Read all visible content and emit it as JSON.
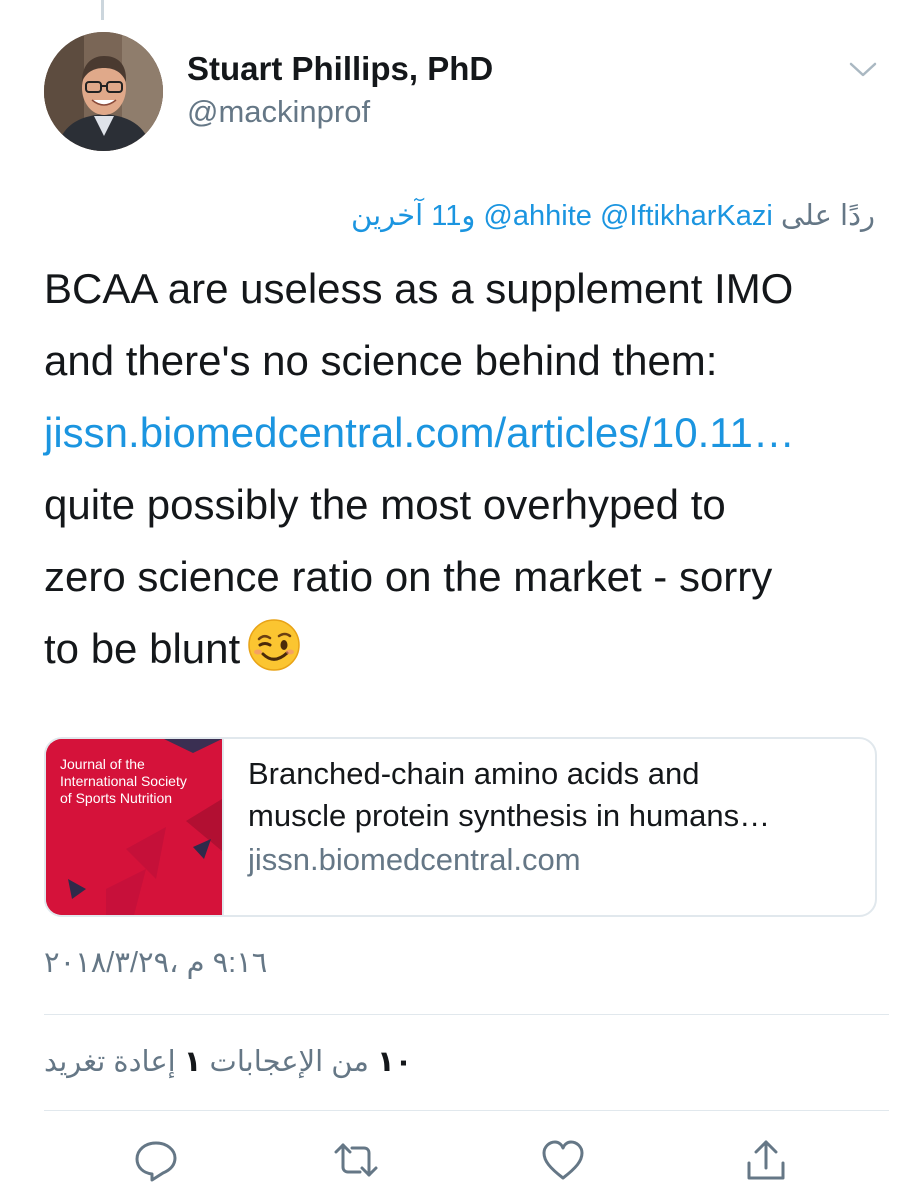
{
  "author": {
    "name": "Stuart Phillips, PhD",
    "handle": "@mackinprof"
  },
  "reply": {
    "prefix": "ردًا على",
    "mention_1": "@IftikharKazi",
    "mention_2": "@ahhite",
    "others": "و11 آخرين"
  },
  "tweet": {
    "line_1": "BCAA are useless as a supplement IMO",
    "line_2": "and there's no science behind them:",
    "link": "jissn.biomedcentral.com/articles/10.11…",
    "line_4": "quite possibly the most overhyped to",
    "line_5": "zero science ratio on the market - sorry",
    "line_6": "to be blunt",
    "emoji": "winking-face"
  },
  "card": {
    "thumb_line_1": "Journal of the",
    "thumb_line_2": "International Society",
    "thumb_line_3": "of Sports Nutrition",
    "title_line_1": "Branched-chain amino acids and",
    "title_line_2": "muscle protein synthesis in humans…",
    "domain": "jissn.biomedcentral.com",
    "thumb_color": "#d5123a"
  },
  "timestamp": "٩:١٦ م ،٢٠١٨/٣/٢٩",
  "stats": {
    "likes_count": "١٠",
    "likes_label": "من الإعجابات",
    "retweets_count": "١",
    "retweets_label": "إعادة تغريد"
  },
  "actions": [
    "reply-icon",
    "retweet-icon",
    "like-icon",
    "share-icon"
  ],
  "colors": {
    "link": "#1b95e0",
    "secondary_text": "#657786",
    "primary_text": "#14171a",
    "divider": "#e1e8ed"
  }
}
